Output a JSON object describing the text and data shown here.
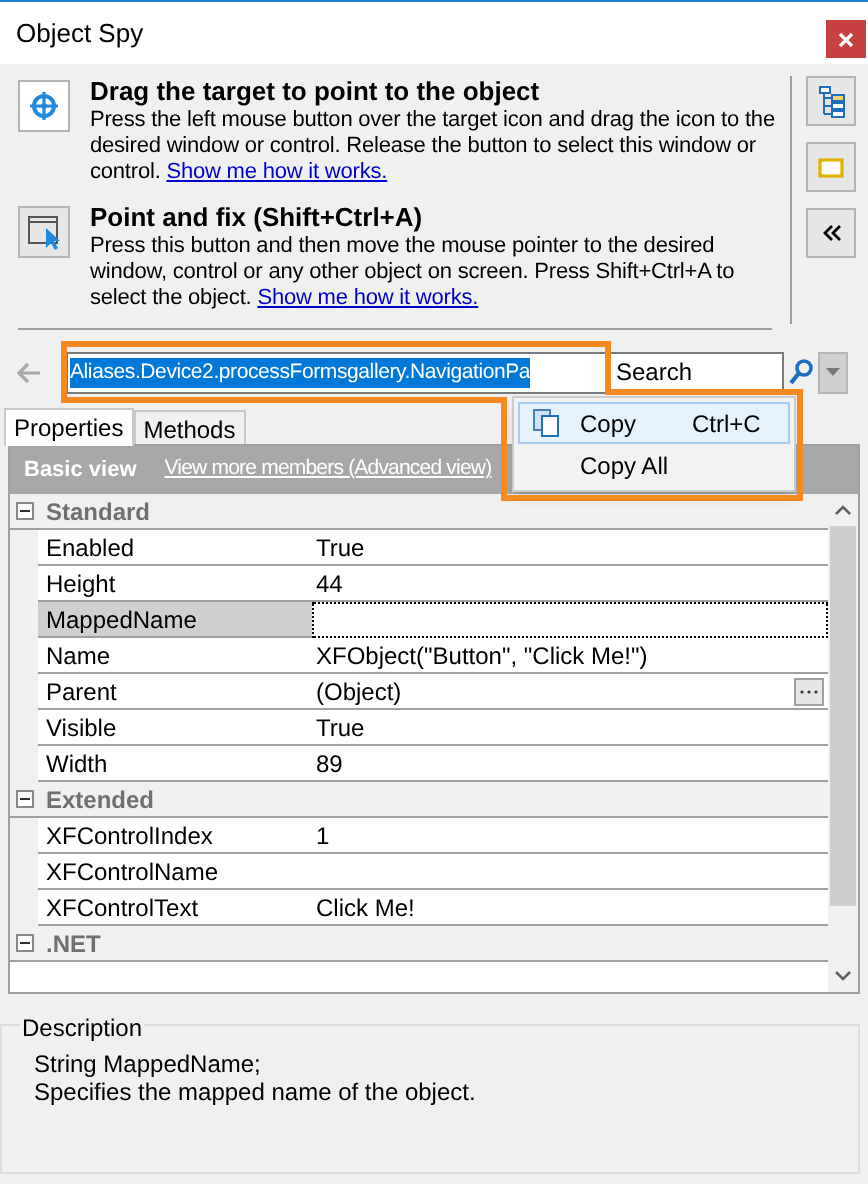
{
  "window": {
    "title": "Object Spy"
  },
  "instructions": [
    {
      "kind": "target",
      "title": "Drag the target to point to the object",
      "text": "Press the left mouse button over the target icon and drag the icon to the desired window or control. Release the button to select this window or control.",
      "link": "Show me how it works."
    },
    {
      "kind": "pointer",
      "title": "Point and fix (Shift+Ctrl+A)",
      "text": "Press this button and then move the mouse pointer to the desired window, control or any other object on screen. Press Shift+Ctrl+A to select the object.",
      "link": "Show me how it works."
    }
  ],
  "address": {
    "value": "Aliases.Device2.processFormsgallery.NavigationPa"
  },
  "search": {
    "value": "Search"
  },
  "context_menu": [
    {
      "label": "Copy",
      "shortcut": "Ctrl+C",
      "selected": true
    },
    {
      "label": "Copy All",
      "selected": false
    }
  ],
  "tabs": [
    {
      "label": "Properties",
      "selected": true
    },
    {
      "label": "Methods",
      "selected": false
    }
  ],
  "grid_header": {
    "title": "Basic view",
    "link": "View more members (Advanced view)"
  },
  "groups": [
    {
      "name": "Standard",
      "expanded": true,
      "properties": [
        {
          "name": "Enabled",
          "value": "True",
          "selected": false
        },
        {
          "name": "Height",
          "value": "44",
          "selected": false
        },
        {
          "name": "MappedName",
          "selected": true
        },
        {
          "name": "Name",
          "value": "XFObject(\"Button\", \"Click Me!\")",
          "selected": false
        },
        {
          "name": "Parent",
          "value": "(Object)",
          "selected": false,
          "kind": "object"
        },
        {
          "name": "Visible",
          "value": "True",
          "selected": false
        },
        {
          "name": "Width",
          "value": "89",
          "selected": false
        }
      ]
    },
    {
      "name": "Extended",
      "expanded": true,
      "properties": [
        {
          "name": "XFControlIndex",
          "value": "1",
          "selected": false
        },
        {
          "name": "XFControlName",
          "selected": false
        },
        {
          "name": "XFControlText",
          "value": "Click Me!",
          "selected": false
        }
      ]
    },
    {
      "name": ".NET",
      "expanded": true
    }
  ],
  "description": {
    "title": "Description",
    "lines": [
      "String MappedName;",
      "Specifies the mapped name of the object."
    ]
  }
}
